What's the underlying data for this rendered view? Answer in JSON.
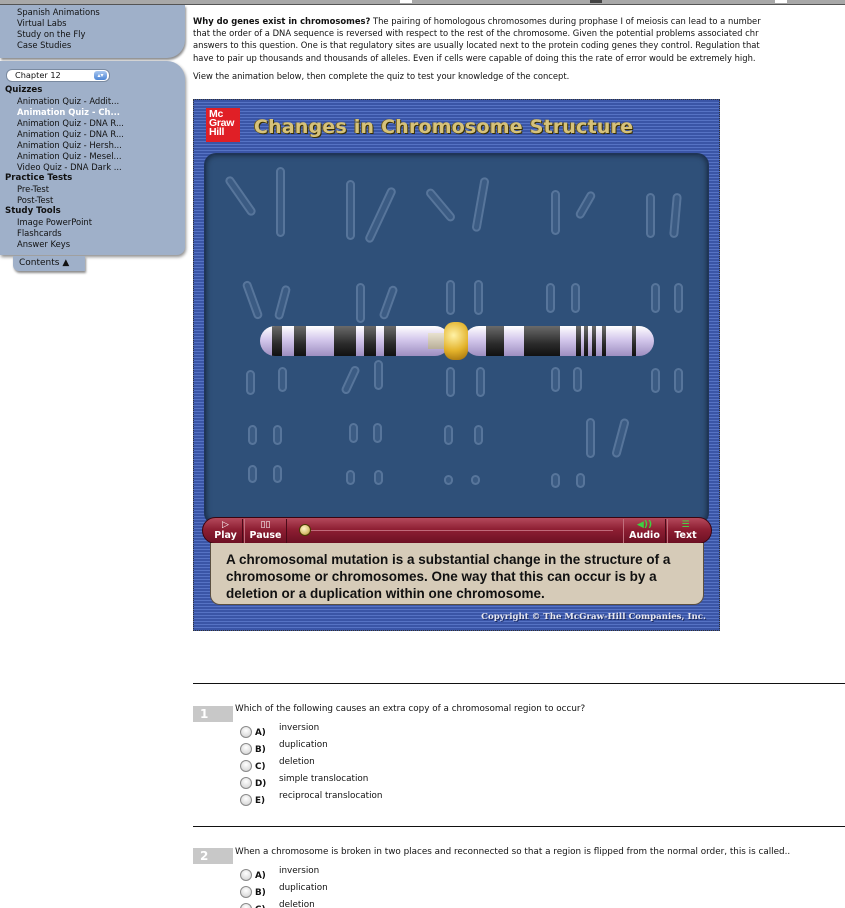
{
  "sidebar": {
    "top_links": [
      "Spanish Animations",
      "Virtual Labs",
      "Study on the Fly",
      "Case Studies"
    ],
    "chapter_select": {
      "value": "Chapter 12"
    },
    "sections": [
      {
        "title": "Quizzes",
        "items": [
          {
            "label": "Animation Quiz - Addit...",
            "active": false
          },
          {
            "label": "Animation Quiz - Ch...",
            "active": true
          },
          {
            "label": "Animation Quiz - DNA R...",
            "active": false
          },
          {
            "label": "Animation Quiz - DNA R...",
            "active": false
          },
          {
            "label": "Animation Quiz - Hersh...",
            "active": false
          },
          {
            "label": "Animation Quiz - Mesel...",
            "active": false
          },
          {
            "label": "Video Quiz - DNA Dark ...",
            "active": false
          }
        ]
      },
      {
        "title": "Practice Tests",
        "items": [
          {
            "label": "Pre-Test",
            "active": false
          },
          {
            "label": "Post-Test",
            "active": false
          }
        ]
      },
      {
        "title": "Study Tools",
        "items": [
          {
            "label": "Image PowerPoint",
            "active": false
          },
          {
            "label": "Flashcards",
            "active": false
          },
          {
            "label": "Answer Keys",
            "active": false
          }
        ]
      }
    ],
    "contents_tab": "Contents ▲"
  },
  "main": {
    "intro_heading": "Why do genes exist in chromosomes?",
    "intro_lines": [
      " The pairing of homologous chromosomes during prophase I of meiosis can lead to a number",
      "that the order of a DNA sequence is reversed with respect to the rest of the chromosome. Given the potential problems associated chr",
      "answers to this question. One is that regulatory sites are usually located next to the protein coding genes they control. Regulation that",
      "have to pair up thousands and thousands of alleles. Even if cells were capable of doing this the rate of error would be extremely high."
    ],
    "instruction": "View the animation below, then complete the quiz to test your knowledge of the concept."
  },
  "animation": {
    "logo_lines": [
      "Mc",
      "Graw",
      "Hill"
    ],
    "title": "Changes in Chromosome Structure",
    "controls": {
      "play": {
        "icon": "▷",
        "label": "Play"
      },
      "pause": {
        "icon": "▯▯",
        "label": "Pause"
      },
      "audio": {
        "icon": "◀))",
        "label": "Audio"
      },
      "text": {
        "icon": "☰",
        "label": "Text"
      },
      "progress": 0.0
    },
    "caption": "A chromosomal mutation is a substantial change in the structure of a chromosome or chromosomes.  One way that this can occur is by a deletion or a duplication within one chromosome.",
    "copyright": "Copyright © The McGraw-Hill Companies, Inc.",
    "colors": {
      "frame": "#3a55a6",
      "title": "#d6c27a",
      "logo": "#e01f26",
      "controls": "#8e1f33",
      "caption_bg": "#d6cbb8"
    }
  },
  "quiz": {
    "questions": [
      {
        "number": "1",
        "text": "Which of the following causes an extra copy of a chromosomal region to occur?",
        "options": [
          {
            "letter": "A)",
            "text": "inversion"
          },
          {
            "letter": "B)",
            "text": "duplication"
          },
          {
            "letter": "C)",
            "text": "deletion"
          },
          {
            "letter": "D)",
            "text": "simple translocation"
          },
          {
            "letter": "E)",
            "text": "reciprocal translocation"
          }
        ]
      },
      {
        "number": "2",
        "text": "When a chromosome is broken in two places and reconnected so that a region is flipped from the normal order, this is called..",
        "options": [
          {
            "letter": "A)",
            "text": "inversion"
          },
          {
            "letter": "B)",
            "text": "duplication"
          },
          {
            "letter": "C)",
            "text": "deletion"
          }
        ]
      }
    ]
  }
}
